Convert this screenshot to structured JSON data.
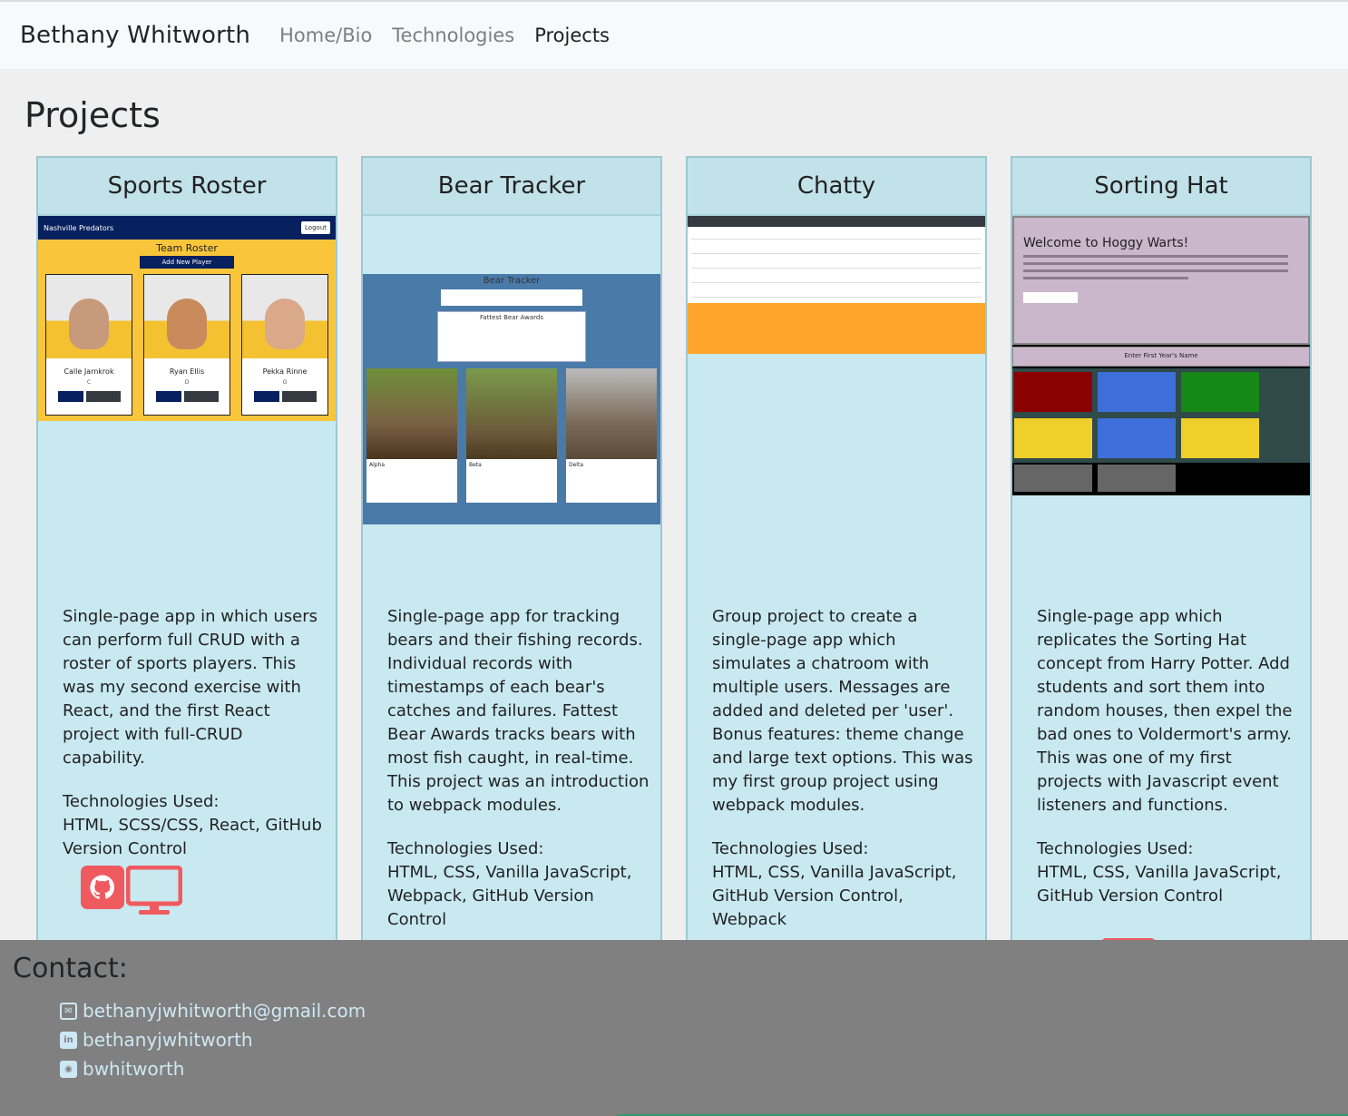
{
  "navbar": {
    "brand": "Bethany Whitworth",
    "links": [
      "Home/Bio",
      "Technologies",
      "Projects"
    ],
    "active": "Projects"
  },
  "page": {
    "title": "Projects"
  },
  "cards": [
    {
      "title": "Sports Roster",
      "description": "Single-page app in which users can perform full CRUD with a roster of sports players. This was my second exercise with React, and the first React project with full-CRUD capability.",
      "tech_label": "Technologies Used:",
      "tech": "HTML, SCSS/CSS, React, GitHub Version Control",
      "screenshot": {
        "team": "Nashville Predators",
        "logout": "Logout",
        "heading": "Team Roster",
        "add_button": "Add New Player",
        "players": [
          {
            "name": "Calle Jarnkrok",
            "pos": "C"
          },
          {
            "name": "Ryan Ellis",
            "pos": "D"
          },
          {
            "name": "Pekka Rinne",
            "pos": "G"
          }
        ]
      }
    },
    {
      "title": "Bear Tracker",
      "description": "Single-page app for tracking bears and their fishing records. Individual records with timestamps of each bear's catches and failures. Fattest Bear Awards tracks bears with most fish caught, in real-time. This project was an introduction to webpack modules.",
      "tech_label": "Technologies Used:",
      "tech": "HTML, CSS, Vanilla JavaScript, Webpack, GitHub Version Control",
      "screenshot": {
        "heading": "Bear Tracker",
        "awards": "Fattest Bear Awards",
        "bears": [
          "Alpha",
          "Beta",
          "Delta"
        ]
      }
    },
    {
      "title": "Chatty",
      "description": "Group project to create a single-page app which simulates a chatroom with multiple users. Messages are added and deleted per 'user'. Bonus features: theme change and large text options. This was my first group project using webpack modules.",
      "tech_label": "Technologies Used:",
      "tech": "HTML, CSS, Vanilla JavaScript, GitHub Version Control, Webpack"
    },
    {
      "title": "Sorting Hat",
      "description": "Single-page app which replicates the Sorting Hat concept from Harry Potter. Add students and sort them into random houses, then expel the bad ones to Voldermort's army. This was one of my first projects with Javascript event listeners and functions.",
      "tech_label": "Technologies Used:",
      "tech": "HTML, CSS, Vanilla JavaScript, GitHub Version Control",
      "screenshot": {
        "welcome": "Welcome to Hoggy Warts!",
        "form_label": "Enter First Year's Name"
      }
    }
  ],
  "contact": {
    "title": "Contact:",
    "email": "bethanyjwhitworth@gmail.com",
    "linkedin": "bethanyjwhitworth",
    "github": "bwhitworth"
  },
  "colors": {
    "card_bg": "#c9e9f1",
    "link_button": "#ef5a5f",
    "footer_bg": "#808080",
    "contact_link": "#cde8f5"
  }
}
